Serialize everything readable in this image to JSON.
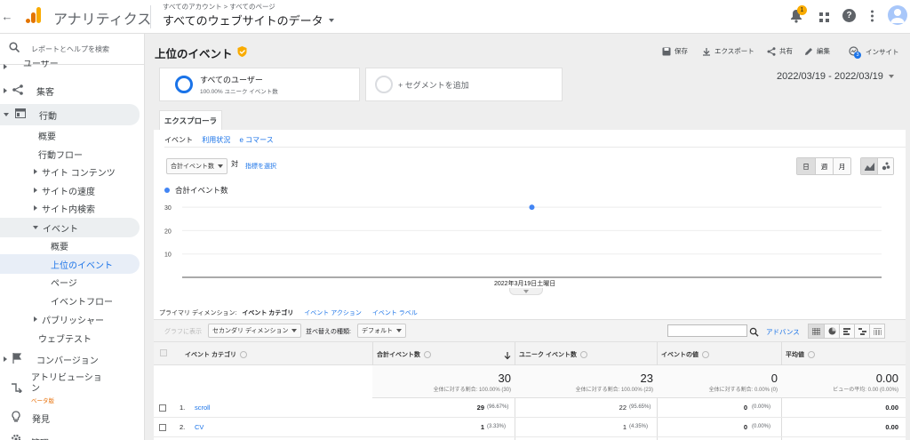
{
  "app": {
    "name": "アナリティクス",
    "brand_color": "#f9ab00"
  },
  "header": {
    "breadcrumb": [
      "すべてのアカウント",
      "すべてのページ"
    ],
    "breadcrumb_sep": ">",
    "view_title": "すべてのウェブサイトのデータ",
    "notification_count": "1"
  },
  "sidebar": {
    "search_placeholder": "レポートとヘルプを検索",
    "items": [
      {
        "label": "ユーザー",
        "level": 0,
        "icon": "person-icon"
      },
      {
        "label": "集客",
        "level": 0,
        "icon": "acquisition-icon"
      },
      {
        "label": "行動",
        "level": 0,
        "icon": "behavior-icon",
        "expanded": true
      },
      {
        "label": "概要",
        "level": 1
      },
      {
        "label": "行動フロー",
        "level": 1
      },
      {
        "label": "サイト コンテンツ",
        "level": 1,
        "collapsed": true
      },
      {
        "label": "サイトの速度",
        "level": 1,
        "collapsed": true
      },
      {
        "label": "サイト内検索",
        "level": 1,
        "collapsed": true
      },
      {
        "label": "イベント",
        "level": 1,
        "expanded": true
      },
      {
        "label": "概要",
        "level": 2
      },
      {
        "label": "上位のイベント",
        "level": 2,
        "active": true
      },
      {
        "label": "ページ",
        "level": 2
      },
      {
        "label": "イベントフロー",
        "level": 2
      },
      {
        "label": "パブリッシャー",
        "level": 1,
        "collapsed": true
      },
      {
        "label": "ウェブテスト",
        "level": 1
      },
      {
        "label": "コンバージョン",
        "level": 0,
        "icon": "flag-icon"
      },
      {
        "label": "アトリビューション",
        "level": 0,
        "icon": "attribution-icon"
      },
      {
        "label": "発見",
        "level": 0,
        "icon": "bulb-icon"
      },
      {
        "label": "管理",
        "level": 0,
        "icon": "gear-icon"
      }
    ],
    "attribution_badge": "ベータ版"
  },
  "report": {
    "title": "上位のイベント",
    "toolbar": {
      "save": "保存",
      "export": "エクスポート",
      "share": "共有",
      "edit": "編集",
      "insight": "インサイト"
    },
    "insight_badge": "3",
    "date_range": "2022/03/19 - 2022/03/19",
    "segments": {
      "all_users": "すべてのユーザー",
      "all_users_sub": "100.00% ユニーク イベント数",
      "add_segment": "+ セグメントを追加"
    },
    "explorer_tab": "エクスプローラ",
    "subtabs": [
      "イベント",
      "利用状況",
      "e コマース"
    ],
    "metric_select": "合計イベント数",
    "vs_label": "対",
    "select_metric_link": "指標を選択",
    "period_buttons": [
      "日",
      "週",
      "月"
    ],
    "legend_label": "合計イベント数"
  },
  "chart_data": {
    "type": "line",
    "x": [
      "2022年3月19日土曜日"
    ],
    "series": [
      {
        "name": "合計イベント数",
        "values": [
          30
        ],
        "color": "#4285f4"
      }
    ],
    "yticks": [
      10,
      20,
      30
    ],
    "ylim": [
      0,
      35
    ],
    "grid": true
  },
  "table": {
    "primary_dim_label": "プライマリ ディメンション:",
    "dims": [
      "イベント カテゴリ",
      "イベント アクション",
      "イベント ラベル"
    ],
    "secondary_label": "グラフに表示",
    "secondary_dim": "セカンダリ ディメンション",
    "sort_label": "並べ替えの種類:",
    "sort_value": "デフォルト",
    "advanced_link": "アドバンス",
    "headers": [
      "イベント カテゴリ",
      "合計イベント数",
      "ユニーク イベント数",
      "イベントの値",
      "平均値"
    ],
    "totals": [
      {
        "value": "30",
        "sub": "全体に対する割合: 100.00% (30)"
      },
      {
        "value": "23",
        "sub": "全体に対する割合: 100.00% (23)"
      },
      {
        "value": "0",
        "sub": "全体に対する割合: 0.00% (0)"
      },
      {
        "value": "0.00",
        "sub": "ビューの平均: 0.00 (0.00%)"
      }
    ],
    "rows": [
      {
        "idx": "1.",
        "name": "scroll",
        "total": "29",
        "total_pct": "(96.67%)",
        "unique": "22",
        "unique_pct": "(95.65%)",
        "value": "0",
        "value_pct": "(0.00%)",
        "avg": "0.00"
      },
      {
        "idx": "2.",
        "name": "CV",
        "total": "1",
        "total_pct": "(3.33%)",
        "unique": "1",
        "unique_pct": "(4.35%)",
        "value": "0",
        "value_pct": "(0.00%)",
        "avg": "0.00"
      }
    ]
  }
}
